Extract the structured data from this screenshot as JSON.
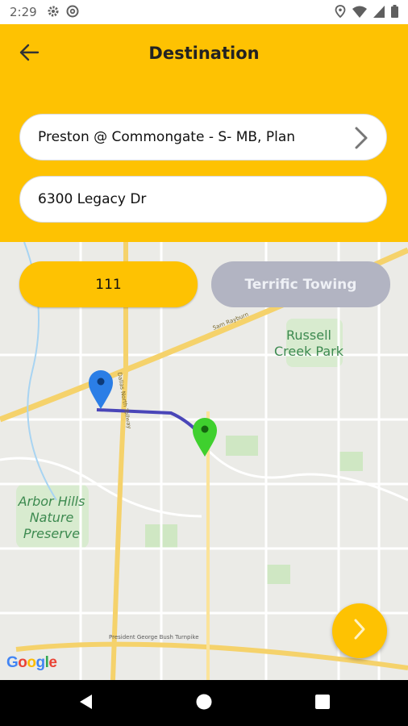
{
  "status_bar": {
    "time": "2:29",
    "left_icons": [
      "gear-icon",
      "at-sign-icon"
    ],
    "right_icons": [
      "location-pin-icon",
      "wifi-icon",
      "signal-icon",
      "battery-icon"
    ]
  },
  "header": {
    "title": "Destination",
    "back_icon": "arrow-left-icon",
    "background": "#fec202"
  },
  "pickup": {
    "value": "Preston @ Commongate - S- MB, Plan"
  },
  "destination": {
    "value": "6300 Legacy Dr"
  },
  "buttons": {
    "primary_label": "111",
    "secondary_label": "Terrific Towing"
  },
  "map": {
    "labels": {
      "russell_line1": "Russell",
      "russell_line2": "Creek Park",
      "arbor_line1": "Arbor Hills",
      "arbor_line2": "Nature",
      "arbor_line3": "Preserve",
      "sam_rayburn": "Sam Rayburn",
      "dallas_north": "Dallas North Tollway",
      "bush_turnpike": "President George Bush Turnpike"
    },
    "markers": {
      "origin_color": "#2b7ee6",
      "destination_color": "#3fd02e",
      "route_color": "#4a46b8"
    },
    "attribution": "Google"
  },
  "fab": {
    "icon": "chevron-right-icon"
  },
  "nav": {
    "icons": [
      "back-triangle-icon",
      "home-circle-icon",
      "recents-square-icon"
    ]
  }
}
